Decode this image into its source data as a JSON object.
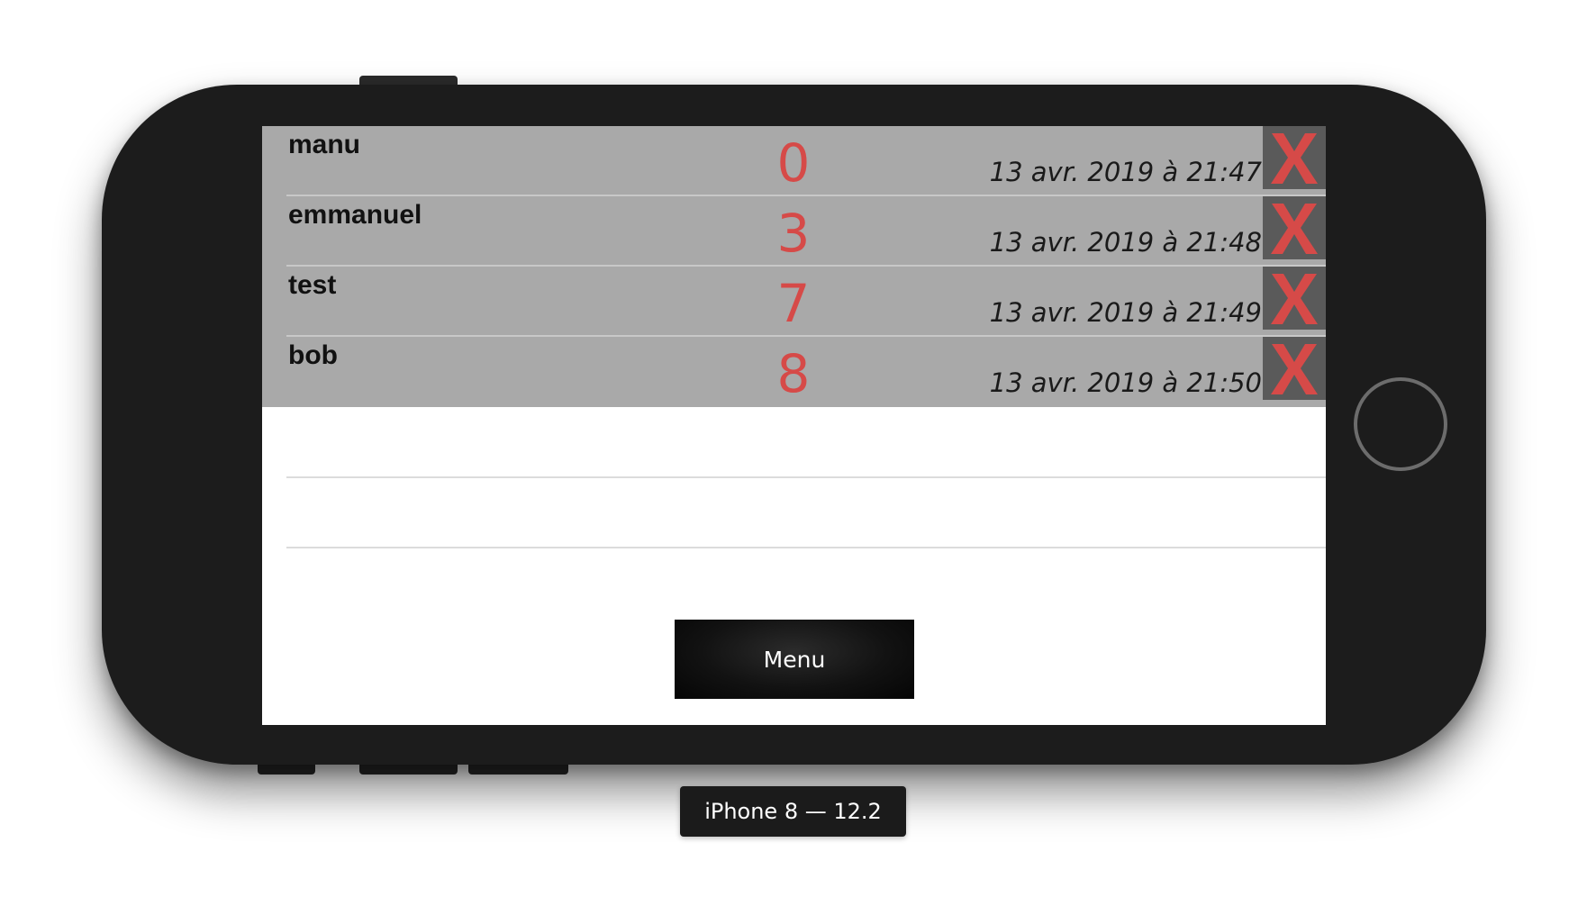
{
  "device": {
    "label": "iPhone 8 — 12.2"
  },
  "leaderboard": {
    "entries": [
      {
        "name": "manu",
        "score": "0",
        "date": "13 avr. 2019 à 21:47"
      },
      {
        "name": "emmanuel",
        "score": "3",
        "date": "13 avr. 2019 à 21:48"
      },
      {
        "name": "test",
        "score": "7",
        "date": "13 avr. 2019 à 21:49"
      },
      {
        "name": "bob",
        "score": "8",
        "date": "13 avr. 2019 à 21:50"
      }
    ],
    "delete_icon": "close-x-icon"
  },
  "menu": {
    "button_label": "Menu"
  },
  "colors": {
    "row_background": "#a9a9a9",
    "score_color": "#d64a48",
    "delete_background": "#5a5a5a",
    "delete_x_color": "#d64a48"
  }
}
